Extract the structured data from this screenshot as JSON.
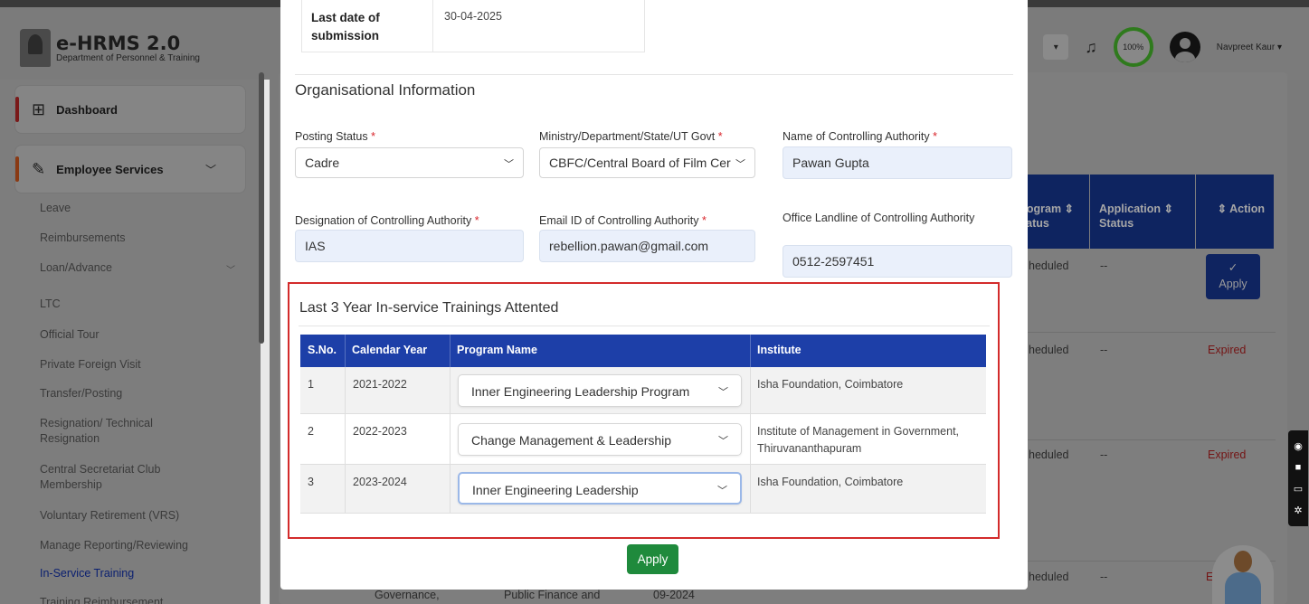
{
  "app": {
    "title": "e-HRMS 2.0",
    "subtitle": "Department of Personnel & Training",
    "profile_completion": "100%",
    "user_name": "Navpreet Kaur ▾"
  },
  "sidebar": {
    "dashboard": "Dashboard",
    "employee_services": "Employee Services",
    "items": [
      "Leave",
      "Reimbursements",
      "Loan/Advance",
      "LTC",
      "Official Tour",
      "Private Foreign Visit",
      "Transfer/Posting",
      "Resignation/ Technical Resignation",
      "Central Secretariat Club Membership",
      "Voluntary Retirement (VRS)",
      "Manage Reporting/Reviewing",
      "In-Service Training",
      "Training Reimbursement"
    ]
  },
  "background_table": {
    "headers": [
      "rogram ⇕ tatus",
      "Application ⇕ Status",
      "⇕ Action"
    ],
    "rows": [
      {
        "program_status": "heduled",
        "app_status": "--",
        "action": "Apply"
      },
      {
        "program_status": "heduled",
        "app_status": "--",
        "action": "Expired"
      },
      {
        "program_status": "heduled",
        "app_status": "--",
        "action": "Expired"
      },
      {
        "program_status": "heduled",
        "app_status": "--",
        "action": "E"
      }
    ],
    "bottom_cells": [
      "Governance,",
      "Public Finance and",
      "09-2024"
    ]
  },
  "modal": {
    "deadline_label": "Last date of submission",
    "deadline_value": "30-04-2025",
    "section_title": "Organisational Information",
    "fields": {
      "posting_status": {
        "label": "Posting Status",
        "value": "Cadre"
      },
      "ministry": {
        "label": "Ministry/Department/State/UT Govt",
        "value": "CBFC/Central Board of Film Cer"
      },
      "controlling_authority_name": {
        "label": "Name of Controlling Authority",
        "value": "Pawan Gupta"
      },
      "controlling_authority_designation": {
        "label": "Designation of Controlling Authority",
        "value": "IAS"
      },
      "controlling_authority_email": {
        "label": "Email ID of Controlling Authority",
        "value": "rebellion.pawan@gmail.com"
      },
      "controlling_authority_landline": {
        "label": "Office Landline of Controlling Authority",
        "value": "0512-2597451"
      }
    },
    "required_mark": "*",
    "trainings": {
      "title": "Last 3 Year In-service Trainings Attented",
      "headers": [
        "S.No.",
        "Calendar Year",
        "Program Name",
        "Institute"
      ],
      "rows": [
        {
          "sno": "1",
          "year": "2021-2022",
          "program": "Inner Engineering Leadership Program",
          "institute": "Isha Foundation, Coimbatore"
        },
        {
          "sno": "2",
          "year": "2022-2023",
          "program": "Change Management & Leadership",
          "institute": "Institute of Management in Government, Thiruvananthapuram"
        },
        {
          "sno": "3",
          "year": "2023-2024",
          "program": "Inner Engineering Leadership",
          "institute": "Isha Foundation, Coimbatore"
        }
      ]
    },
    "apply_label": "Apply"
  },
  "colors": {
    "table_header": "#1d3fa8",
    "apply_button": "#1f8a3c",
    "highlight_border": "#d32b2b",
    "required": "#d9262c"
  },
  "icons": [
    "emblem-logo",
    "bell-icon",
    "user-avatar-icon",
    "dashboard-grid-icon",
    "services-edit-icon",
    "chevron-down-icon",
    "check-icon",
    "camera-icon",
    "video-icon",
    "screen-icon",
    "gear-icon"
  ]
}
